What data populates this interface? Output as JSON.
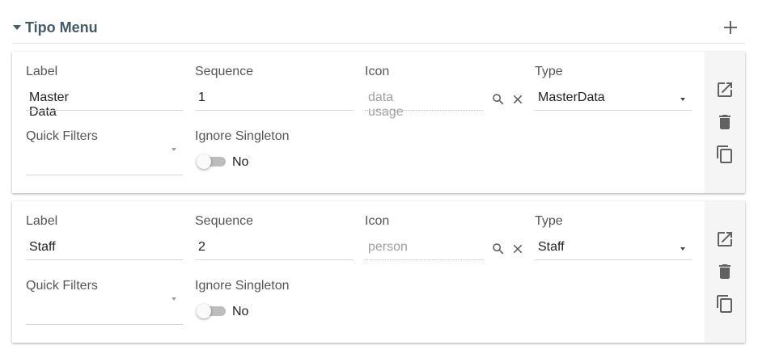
{
  "section": {
    "title": "Tipo Menu"
  },
  "cards": [
    {
      "label_caption": "Label",
      "label_value": "Master Data",
      "sequence_caption": "Sequence",
      "sequence_value": "1",
      "icon_caption": "Icon",
      "icon_placeholder": "data usage",
      "type_caption": "Type",
      "type_value": "MasterData",
      "quick_filters_caption": "Quick Filters",
      "quick_filters_value": "",
      "ignore_singleton_caption": "Ignore Singleton",
      "ignore_singleton_value": "No"
    },
    {
      "label_caption": "Label",
      "label_value": "Staff",
      "sequence_caption": "Sequence",
      "sequence_value": "2",
      "icon_caption": "Icon",
      "icon_placeholder": "person",
      "type_caption": "Type",
      "type_value": "Staff",
      "quick_filters_caption": "Quick Filters",
      "quick_filters_value": "",
      "ignore_singleton_caption": "Ignore Singleton",
      "ignore_singleton_value": "No"
    }
  ],
  "icons": {
    "section_toggle": "caret-down-icon",
    "add": "plus-icon",
    "icon_search": "search-icon",
    "icon_clear": "close-icon",
    "open": "open-in-new-icon",
    "delete": "trash-icon",
    "copy": "copy-icon"
  },
  "colors": {
    "section_title": "#455a64",
    "action_bar": "#f5f5f5",
    "toggle_off": "#bdbdbd"
  }
}
